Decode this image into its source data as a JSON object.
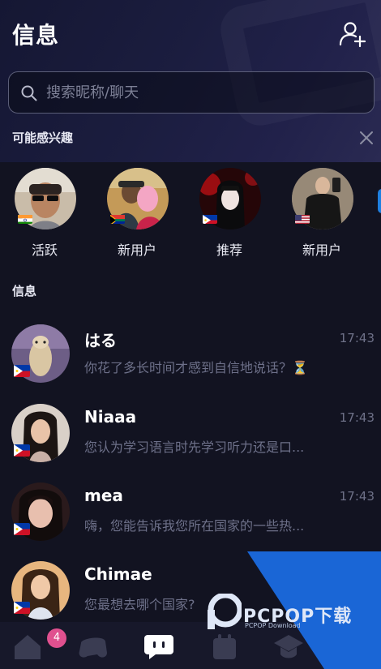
{
  "header": {
    "title": "信息",
    "add_friend_icon": "add-user-icon"
  },
  "search": {
    "placeholder": "搜索昵称/聊天",
    "icon": "search-icon"
  },
  "recommend": {
    "title": "可能感兴趣",
    "close_icon": "close-icon",
    "items": [
      {
        "label": "活跃",
        "flag": "india-flag"
      },
      {
        "label": "新用户",
        "flag": "south-africa-flag"
      },
      {
        "label": "推荐",
        "flag": "philippines-flag"
      },
      {
        "label": "新用户",
        "flag": "usa-flag"
      }
    ]
  },
  "messages": {
    "title": "信息",
    "chats": [
      {
        "name": "はる",
        "time": "17:43",
        "preview": "你花了多长时间才感到自信地说话？⏳",
        "flag": "philippines-flag"
      },
      {
        "name": "Niaaa",
        "time": "17:43",
        "preview": "您认为学习语言时先学习听力还是口...",
        "flag": "philippines-flag"
      },
      {
        "name": "mea",
        "time": "17:43",
        "preview": "嗨，您能告诉我您所在国家的一些热...",
        "flag": "philippines-flag"
      },
      {
        "name": "Chimae",
        "time": "",
        "preview": "您最想去哪个国家?",
        "flag": "philippines-flag"
      }
    ]
  },
  "tabbar": {
    "tabs": [
      {
        "icon": "home-icon",
        "badge": "4"
      },
      {
        "icon": "game-controller-icon"
      },
      {
        "icon": "chat-bubble-icon"
      },
      {
        "icon": "calendar-icon"
      },
      {
        "icon": "graduation-cap-icon"
      }
    ]
  },
  "watermark": {
    "text": "PCPOP下载",
    "sub": "PCPOP Download"
  },
  "colors": {
    "background": "#121321",
    "badge": "#e0508f",
    "muted": "#6d7089",
    "watermark": "#1a66d6"
  }
}
